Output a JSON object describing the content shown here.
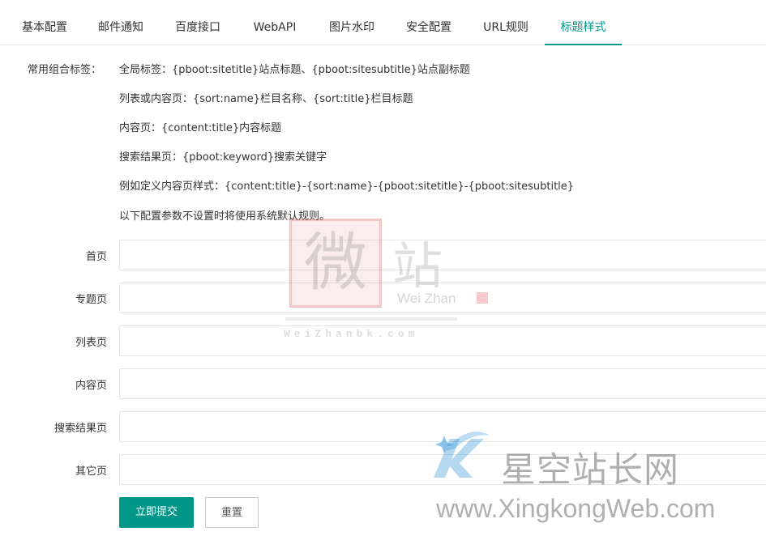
{
  "tabs": [
    {
      "label": "基本配置"
    },
    {
      "label": "邮件通知"
    },
    {
      "label": "百度接口"
    },
    {
      "label": "WebAPI"
    },
    {
      "label": "图片水印"
    },
    {
      "label": "安全配置"
    },
    {
      "label": "URL规则"
    },
    {
      "label": "标题样式",
      "active": true
    }
  ],
  "tags_section": {
    "label": "常用组合标签：",
    "lines": [
      "全局标签：{pboot:sitetitle}站点标题、{pboot:sitesubtitle}站点副标题",
      "列表或内容页：{sort:name}栏目名称、{sort:title}栏目标题",
      "内容页：{content:title}内容标题",
      "搜索结果页：{pboot:keyword}搜索关键字",
      "例如定义内容页样式：{content:title}-{sort:name}-{pboot:sitetitle}-{pboot:sitesubtitle}",
      "以下配置参数不设置时将使用系统默认规则。"
    ]
  },
  "fields": [
    {
      "label": "首页",
      "value": ""
    },
    {
      "label": "专题页",
      "value": ""
    },
    {
      "label": "列表页",
      "value": ""
    },
    {
      "label": "内容页",
      "value": ""
    },
    {
      "label": "搜索结果页",
      "value": ""
    },
    {
      "label": "其它页",
      "value": ""
    }
  ],
  "buttons": {
    "submit": "立即提交",
    "reset": "重置"
  },
  "watermarks": {
    "weizhan_logo_char": "微",
    "weizhan_cn": "站",
    "weizhan_en": "Wei Zhan",
    "weizhan_url": "WeiZhanbk.com",
    "xingkong_cn": "星空站长网",
    "xingkong_url": "www.XingkongWeb.com"
  },
  "colors": {
    "accent": "#009688",
    "watermark_red": "#d9534f",
    "watermark_blue": "#2a8fd8"
  }
}
